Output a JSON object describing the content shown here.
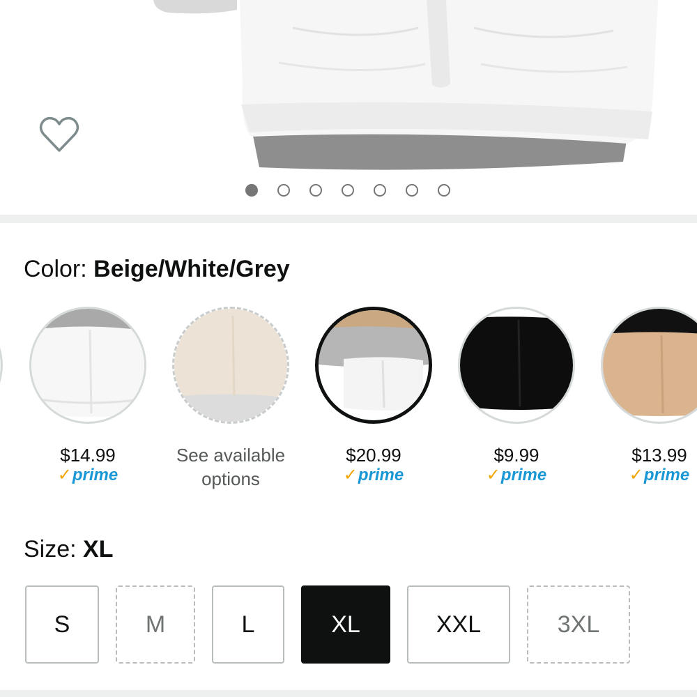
{
  "carousel": {
    "total_images": 7,
    "active_index": 0
  },
  "color": {
    "label": "Color: ",
    "value": "Beige/White/Grey"
  },
  "swatches": [
    {
      "name": "white",
      "price": "$14.99",
      "prime": true,
      "available": true,
      "selected": false
    },
    {
      "name": "beige",
      "price": "",
      "note_line1": "See available",
      "note_line2": "options",
      "prime": false,
      "available": false,
      "selected": false
    },
    {
      "name": "beige-white-grey",
      "price": "$20.99",
      "prime": true,
      "available": true,
      "selected": true
    },
    {
      "name": "black",
      "price": "$9.99",
      "prime": true,
      "available": true,
      "selected": false
    },
    {
      "name": "nude",
      "price": "$13.99",
      "prime": true,
      "available": true,
      "selected": false
    }
  ],
  "prime_label": "prime",
  "prime_check": "✓",
  "size": {
    "label": "Size: ",
    "value": "XL",
    "options": [
      {
        "label": "S",
        "available": true,
        "selected": false
      },
      {
        "label": "M",
        "available": false,
        "selected": false
      },
      {
        "label": "L",
        "available": true,
        "selected": false
      },
      {
        "label": "XL",
        "available": true,
        "selected": true
      },
      {
        "label": "XXL",
        "available": true,
        "selected": false
      },
      {
        "label": "3XL",
        "available": false,
        "selected": false
      }
    ]
  },
  "colors": {
    "prime_blue": "#1a98d5",
    "prime_check": "#f0a500",
    "selected_dark": "#0f1111"
  }
}
